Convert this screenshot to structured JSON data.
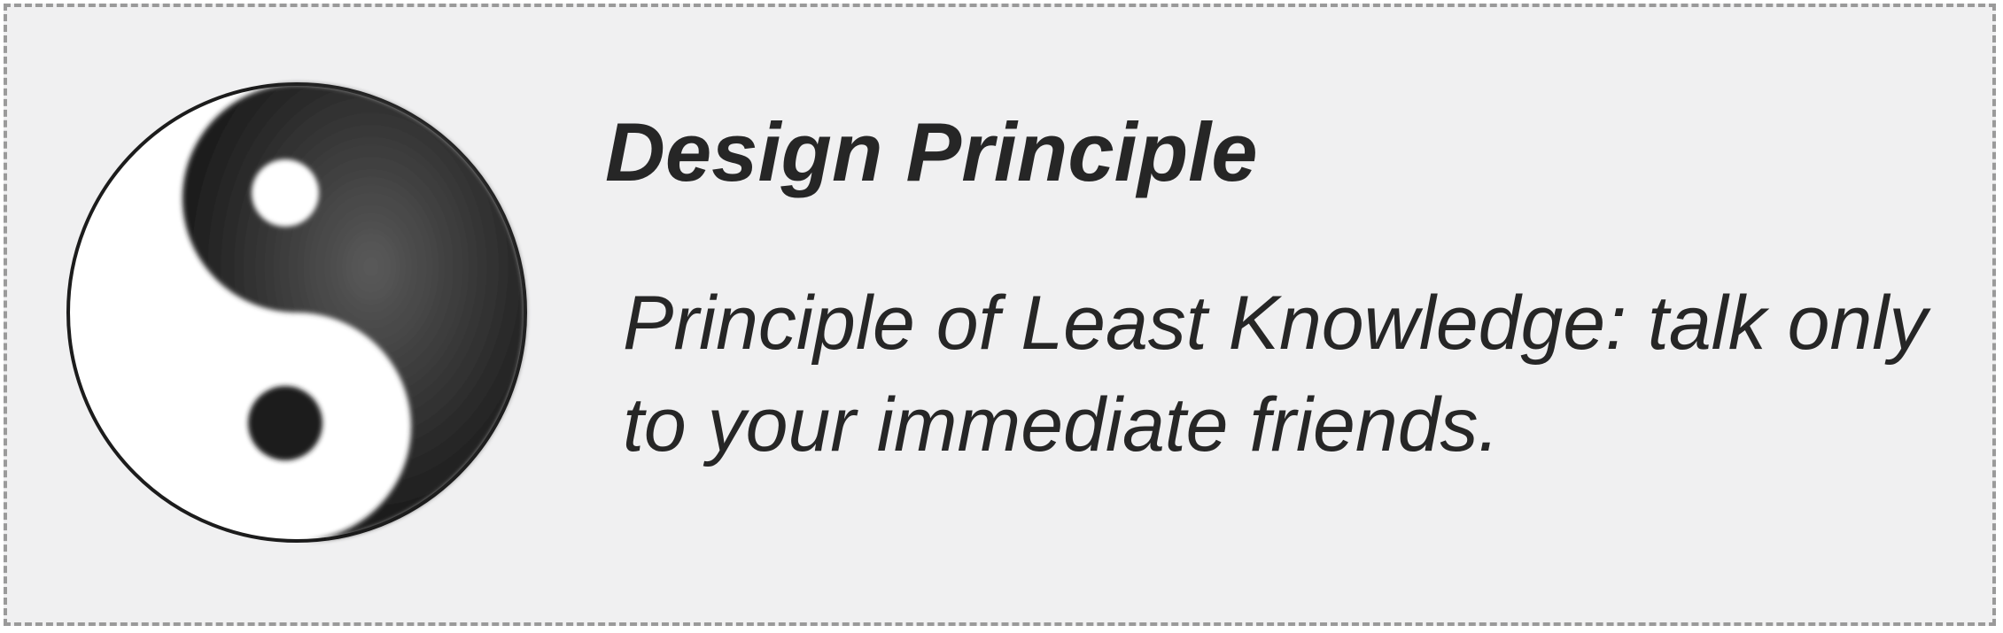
{
  "callout": {
    "icon": "yin-yang-icon",
    "title": "Design Principle",
    "text": "Principle of Least Knowledge: talk only to your immediate friends."
  }
}
